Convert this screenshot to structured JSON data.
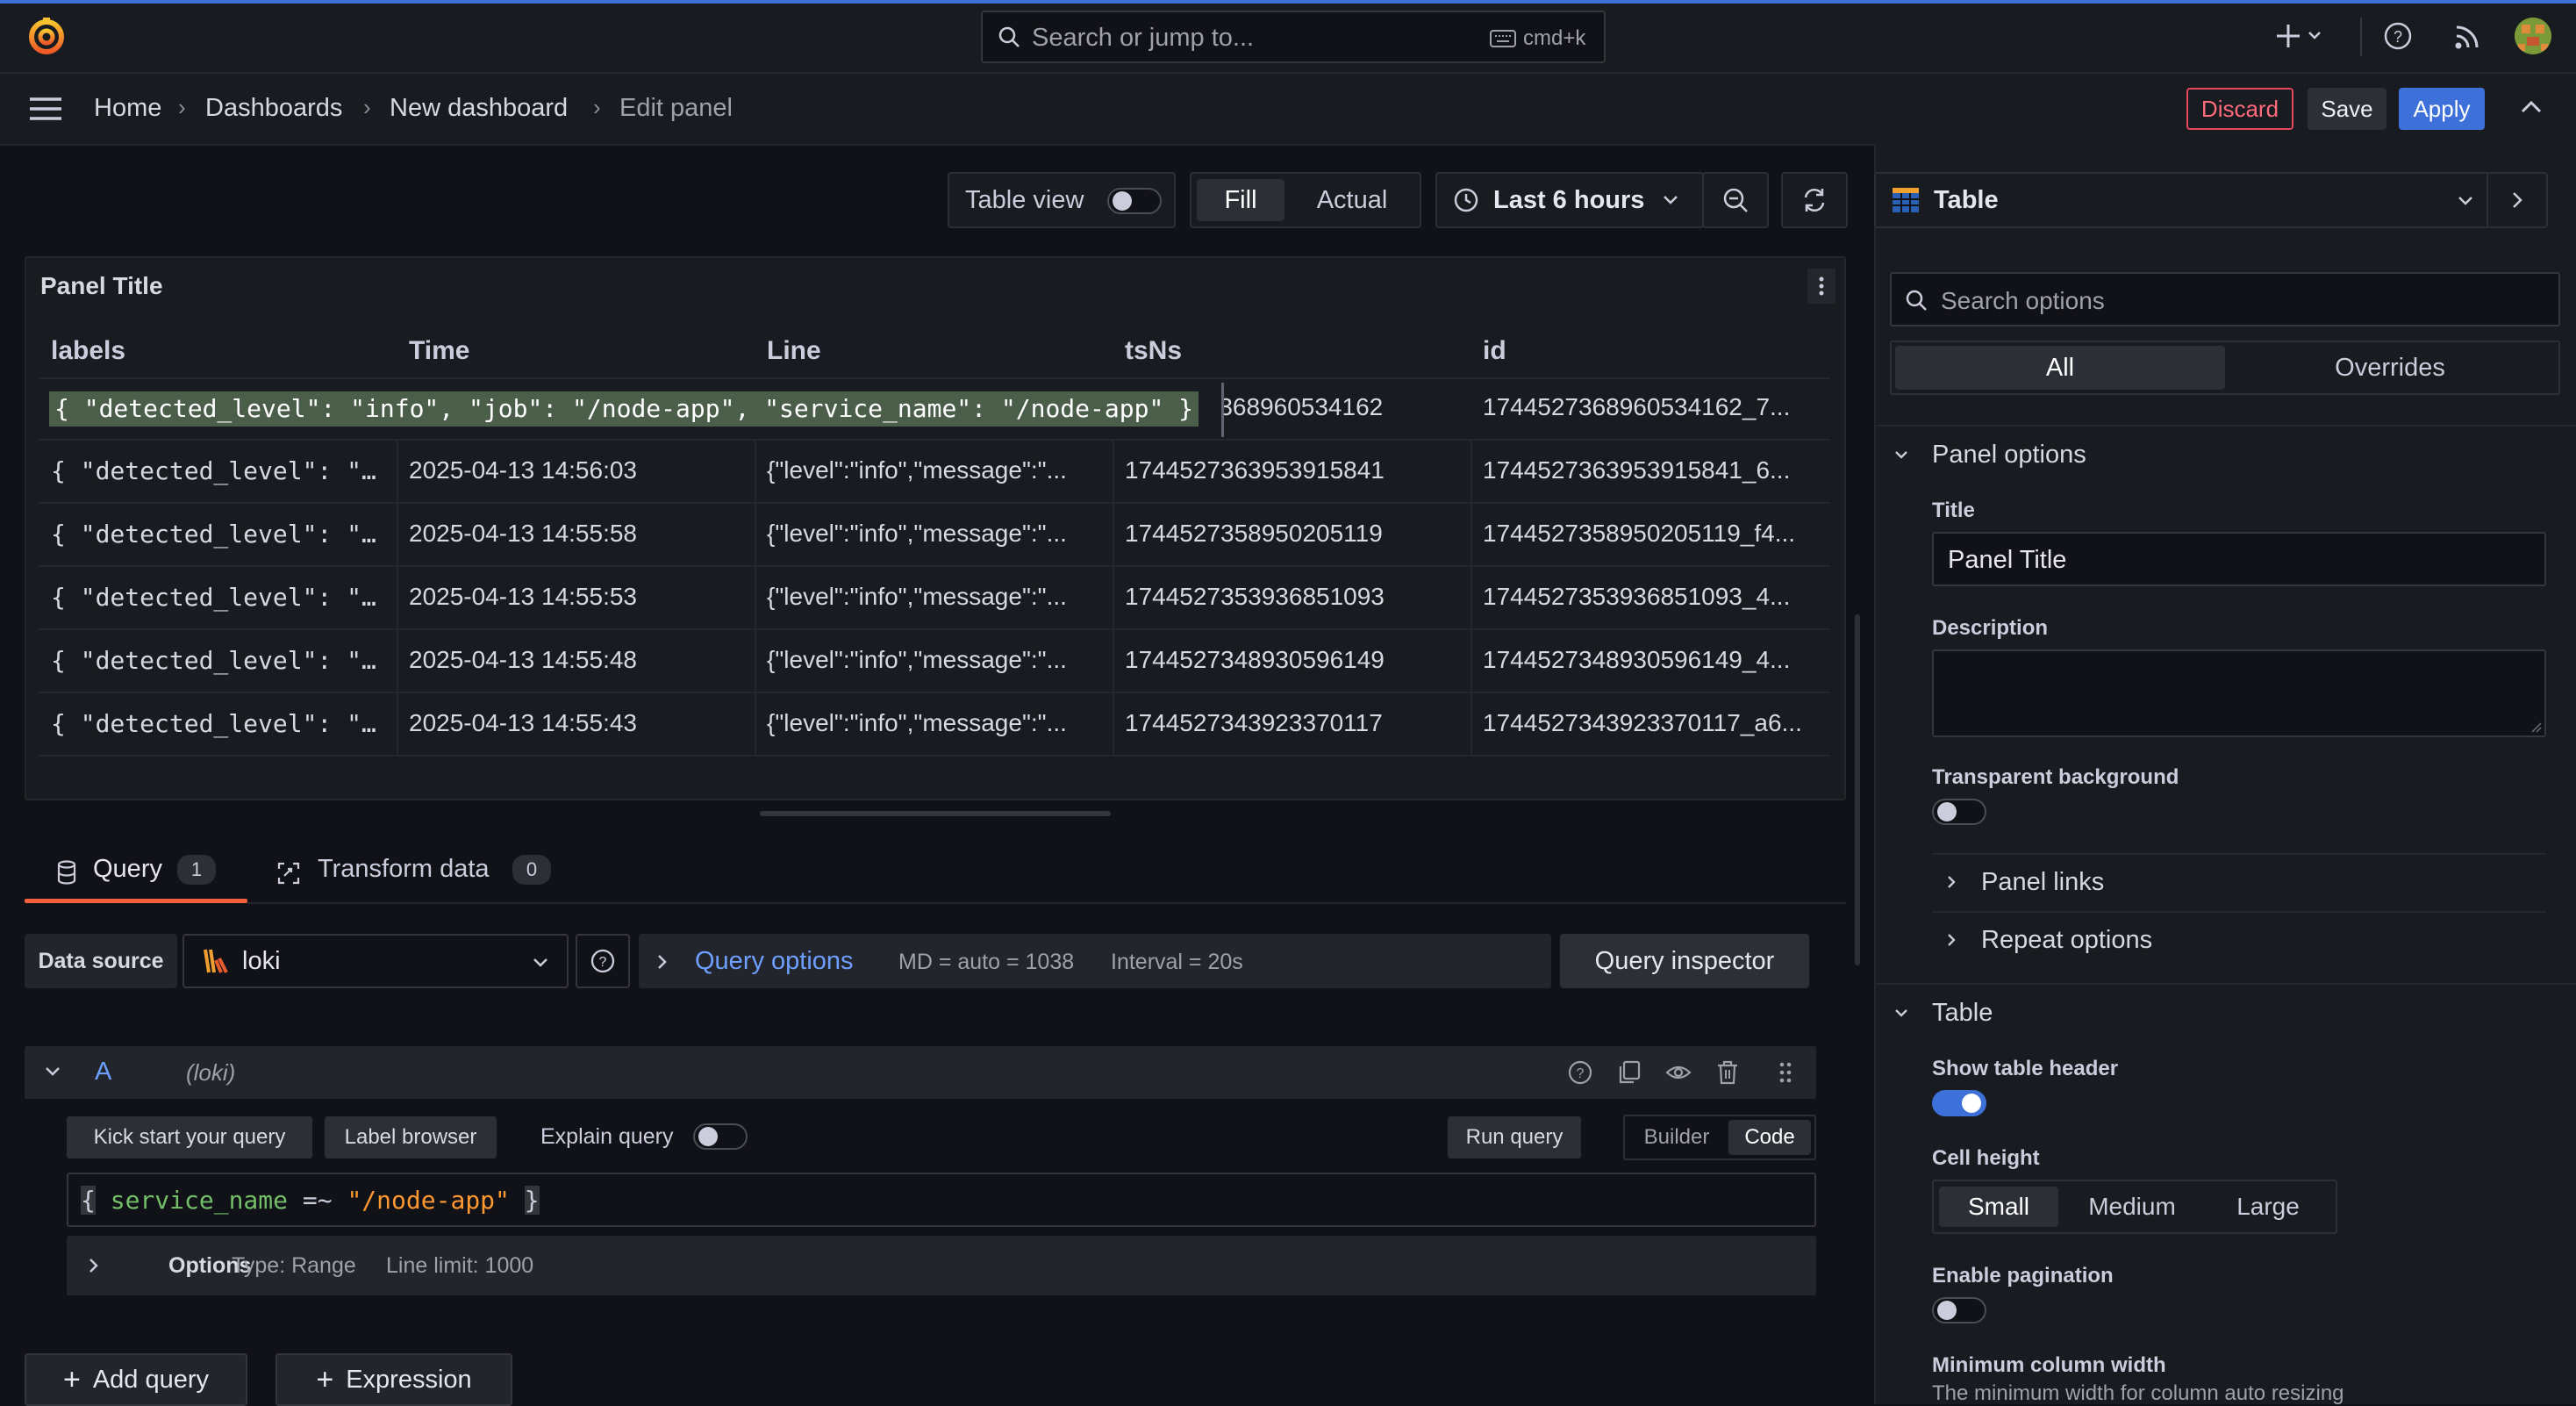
{
  "topbar": {
    "search_placeholder": "Search or jump to...",
    "search_shortcut": "cmd+k"
  },
  "breadcrumbs": {
    "home": "Home",
    "dashboards": "Dashboards",
    "dashboard": "New dashboard",
    "current": "Edit panel"
  },
  "actions": {
    "discard": "Discard",
    "save": "Save",
    "apply": "Apply"
  },
  "toolbar": {
    "table_view": "Table view",
    "fill": "Fill",
    "actual": "Actual",
    "time_range": "Last 6 hours"
  },
  "panel": {
    "title": "Panel Title",
    "columns": [
      "labels",
      "Time",
      "Line",
      "tsNs",
      "id"
    ],
    "selected_row_labels": "{ \"detected_level\": \"info\", \"job\": \"/node-app\", \"service_name\": \"/node-app\" }",
    "rows": [
      {
        "labels": "{ \"detected_level\": \"info\", \"job\": \"/node-app\", \"service_name\": \"/node-app\" }",
        "time": "",
        "line": "",
        "tsns": "'368960534162",
        "id": "1744527368960534162_7..."
      },
      {
        "labels": "{ \"detected_level\": \"…",
        "time": "2025-04-13 14:56:03",
        "line": "{\"level\":\"info\",\"message\":\"...",
        "tsns": "1744527363953915841",
        "id": "1744527363953915841_6..."
      },
      {
        "labels": "{ \"detected_level\": \"…",
        "time": "2025-04-13 14:55:58",
        "line": "{\"level\":\"info\",\"message\":\"...",
        "tsns": "1744527358950205119",
        "id": "1744527358950205119_f4..."
      },
      {
        "labels": "{ \"detected_level\": \"…",
        "time": "2025-04-13 14:55:53",
        "line": "{\"level\":\"info\",\"message\":\"...",
        "tsns": "1744527353936851093",
        "id": "1744527353936851093_4..."
      },
      {
        "labels": "{ \"detected_level\": \"…",
        "time": "2025-04-13 14:55:48",
        "line": "{\"level\":\"info\",\"message\":\"...",
        "tsns": "1744527348930596149",
        "id": "1744527348930596149_4..."
      },
      {
        "labels": "{ \"detected_level\": \"…",
        "time": "2025-04-13 14:55:43",
        "line": "{\"level\":\"info\",\"message\":\"...",
        "tsns": "1744527343923370117",
        "id": "1744527343923370117_a6..."
      }
    ]
  },
  "query_tabs": {
    "query": "Query",
    "query_count": "1",
    "transform": "Transform data",
    "transform_count": "0"
  },
  "datasource": {
    "label": "Data source",
    "value": "loki",
    "query_options": "Query options",
    "md": "MD = auto = 1038",
    "interval": "Interval = 20s",
    "inspector": "Query inspector"
  },
  "query_row": {
    "ref": "A",
    "ds": "(loki)",
    "kick_start": "Kick start your query",
    "label_browser": "Label browser",
    "explain": "Explain query",
    "run": "Run query",
    "builder": "Builder",
    "code": "Code",
    "expr_open": "{",
    "expr_key": "service_name",
    "expr_op": "=~",
    "expr_val": "\"/node-app\"",
    "expr_close": "}",
    "options": "Options",
    "type": "Type: Range",
    "limit": "Line limit: 1000"
  },
  "bottom": {
    "add_query": "Add query",
    "expression": "Expression"
  },
  "options_pane": {
    "viz": "Table",
    "search_placeholder": "Search options",
    "tab_all": "All",
    "tab_overrides": "Overrides",
    "panel_options": "Panel options",
    "title_label": "Title",
    "title_value": "Panel Title",
    "description_label": "Description",
    "transparent_label": "Transparent background",
    "panel_links": "Panel links",
    "repeat_options": "Repeat options",
    "table_section": "Table",
    "show_header": "Show table header",
    "cell_height": "Cell height",
    "small": "Small",
    "medium": "Medium",
    "large": "Large",
    "pagination": "Enable pagination",
    "min_width": "Minimum column width",
    "min_width_desc": "The minimum width for column auto resizing"
  },
  "colors": {
    "accent_blue": "#3d71d9",
    "discard_red": "#e5485d",
    "toggle_on": "#3d71d9",
    "query_tab_underline": "#f55f3e"
  }
}
